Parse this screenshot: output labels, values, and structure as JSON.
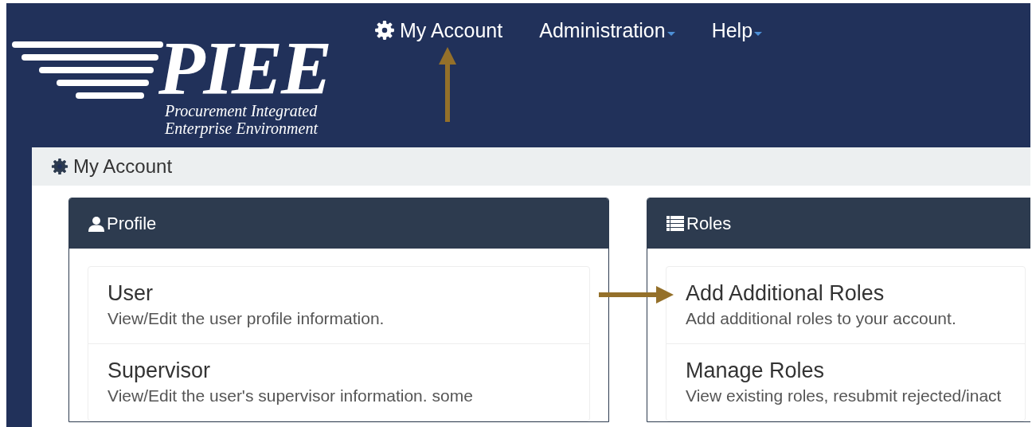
{
  "nav": {
    "logo": {
      "title": "PIEE",
      "subtitle_lines": [
        "Procurement Integrated",
        "Enterprise Environment"
      ]
    },
    "items": [
      {
        "label": "My Account",
        "dropdown": false
      },
      {
        "label": "Administration",
        "dropdown": true
      },
      {
        "label": "Help",
        "dropdown": true
      }
    ]
  },
  "page": {
    "title": "My Account"
  },
  "panels": [
    {
      "title": "Profile",
      "kind": "profile",
      "items": [
        {
          "title": "User",
          "description": "View/Edit the user profile information."
        },
        {
          "title": "Supervisor",
          "description": "View/Edit the user's supervisor information. some"
        }
      ]
    },
    {
      "title": "Roles",
      "kind": "roles",
      "items": [
        {
          "title": "Add Additional Roles",
          "description": "Add additional roles to your account."
        },
        {
          "title": "Manage Roles",
          "description": "View existing roles, resubmit rejected/inact"
        }
      ]
    }
  ]
}
